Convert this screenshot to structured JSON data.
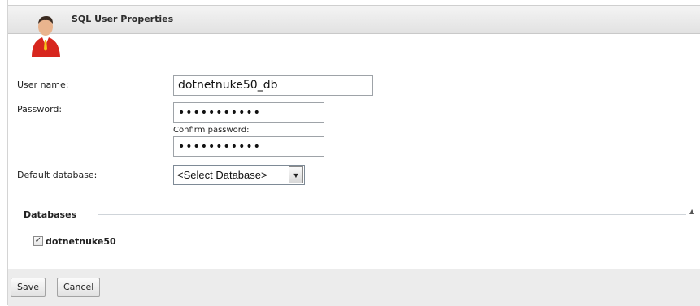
{
  "header": {
    "title": "SQL User Properties"
  },
  "form": {
    "user_name_label": "User name:",
    "user_name_value": "dotnetnuke50_db",
    "password_label": "Password:",
    "password_value": "•••••••••••",
    "confirm_password_label": "Confirm password:",
    "confirm_password_value": "•••••••••••",
    "default_database_label": "Default database:",
    "default_database_selected": "<Select Database>"
  },
  "databases": {
    "section_title": "Databases",
    "collapse_icon": "▲",
    "items": [
      {
        "label": "dotnetnuke50",
        "checked": true
      }
    ]
  },
  "footer": {
    "save_label": "Save",
    "cancel_label": "Cancel"
  },
  "colors": {
    "header_bg": "#e6e6e6",
    "footer_bg": "#ececec",
    "avatar_shirt": "#d7261e"
  }
}
